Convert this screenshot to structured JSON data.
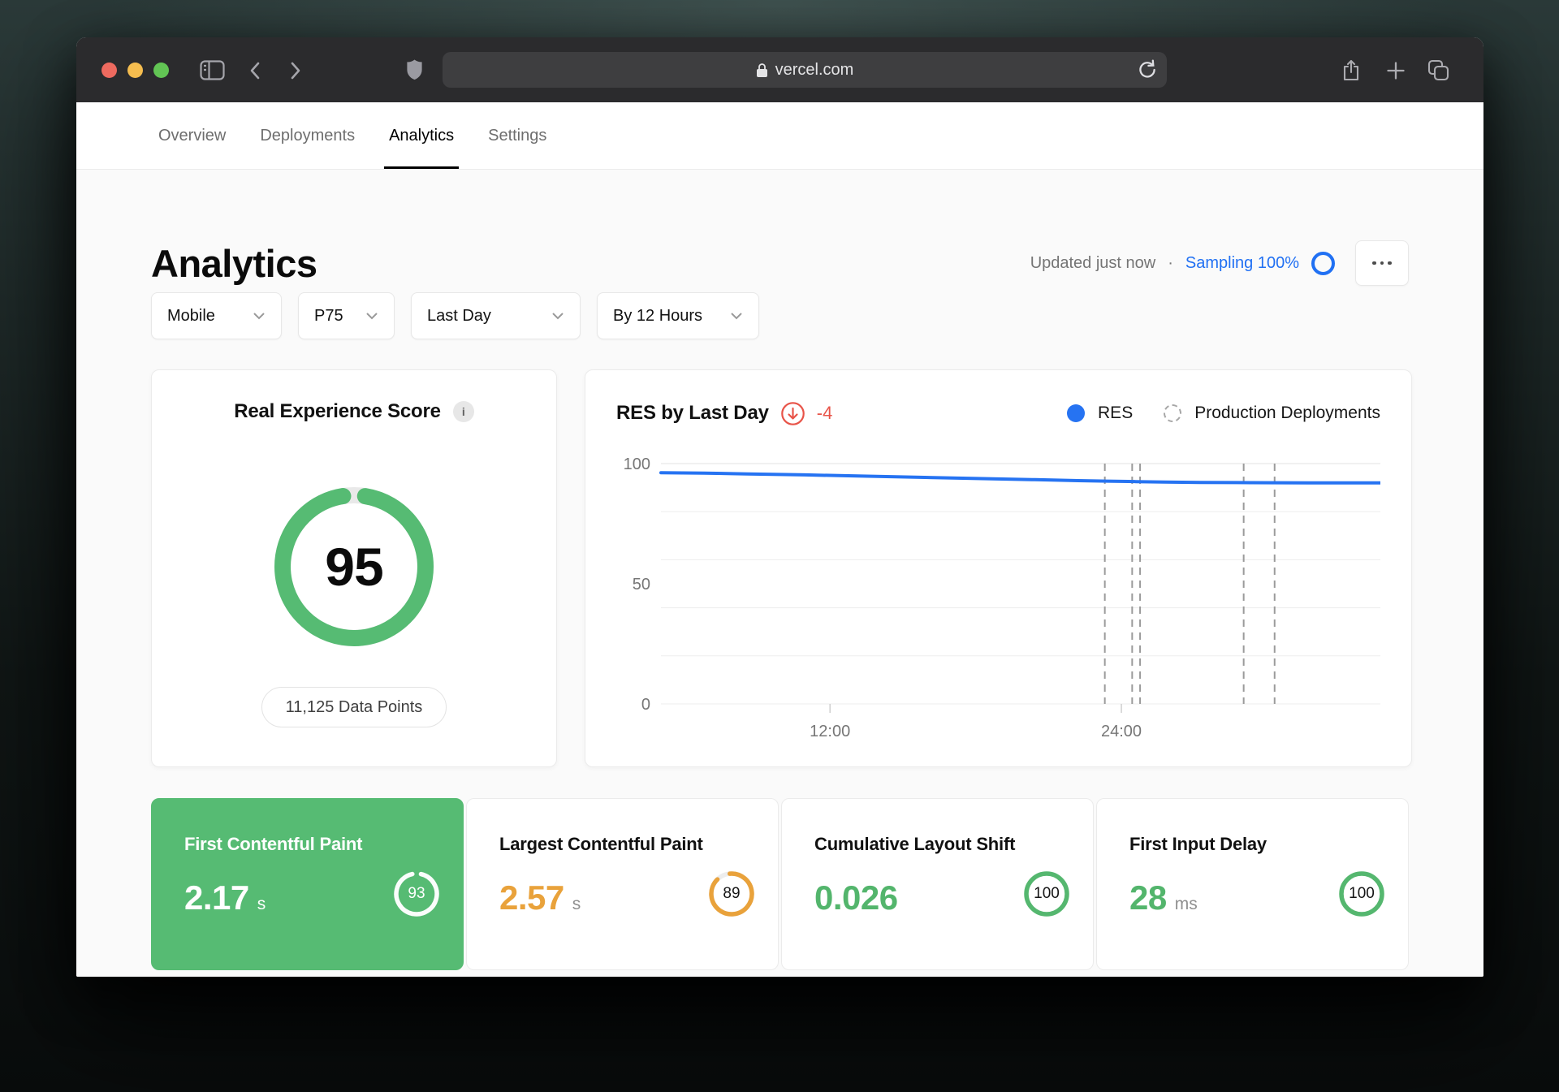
{
  "browser": {
    "url": "vercel.com"
  },
  "tabs": [
    {
      "label": "Overview",
      "active": false
    },
    {
      "label": "Deployments",
      "active": false
    },
    {
      "label": "Analytics",
      "active": true
    },
    {
      "label": "Settings",
      "active": false
    }
  ],
  "header": {
    "title": "Analytics",
    "updated": "Updated just now",
    "separator": "·",
    "sampling": "Sampling 100%"
  },
  "filters": [
    {
      "label": "Mobile"
    },
    {
      "label": "P75"
    },
    {
      "label": "Last Day"
    },
    {
      "label": "By 12 Hours"
    }
  ],
  "res_card": {
    "title": "Real Experience Score",
    "info": "i",
    "score": 95,
    "badge": "11,125 Data Points"
  },
  "chart_data": {
    "type": "line",
    "title": "RES by Last Day",
    "delta": "-4",
    "legend": [
      {
        "label": "RES",
        "marker": "solid-dot",
        "color": "#2673f2"
      },
      {
        "label": "Production Deployments",
        "marker": "dashed-circle",
        "color": "#a6a6a6"
      }
    ],
    "ylim": [
      0,
      100
    ],
    "y_ticks": [
      100,
      50,
      0
    ],
    "y_gridlines": [
      100,
      80,
      60,
      40,
      20,
      0
    ],
    "x_ticks": [
      {
        "label": "12:00",
        "pos": 0.235
      },
      {
        "label": "24:00",
        "pos": 0.64
      }
    ],
    "deployment_markers": [
      0.617,
      0.655,
      0.666,
      0.81,
      0.853
    ],
    "series": [
      {
        "name": "RES",
        "color": "#2673f2",
        "points": [
          [
            0,
            96.2
          ],
          [
            0.06,
            96.0
          ],
          [
            0.12,
            95.7
          ],
          [
            0.2,
            95.3
          ],
          [
            0.28,
            94.8
          ],
          [
            0.36,
            94.3
          ],
          [
            0.44,
            93.8
          ],
          [
            0.52,
            93.3
          ],
          [
            0.58,
            92.9
          ],
          [
            0.62,
            92.7
          ],
          [
            0.66,
            92.5
          ],
          [
            0.7,
            92.3
          ],
          [
            0.75,
            92.15
          ],
          [
            0.82,
            92.05
          ],
          [
            0.9,
            92.0
          ],
          [
            1,
            92.0
          ]
        ]
      }
    ]
  },
  "metrics": [
    {
      "title": "First Contentful Paint",
      "value": "2.17",
      "unit": "s",
      "score": 93,
      "highlighted": true
    },
    {
      "title": "Largest Contentful Paint",
      "value": "2.57",
      "unit": "s",
      "score": 89,
      "highlighted": false
    },
    {
      "title": "Cumulative Layout Shift",
      "value": "0.026",
      "unit": "",
      "score": 100,
      "highlighted": false
    },
    {
      "title": "First Input Delay",
      "value": "28",
      "unit": "ms",
      "score": 100,
      "highlighted": false
    }
  ],
  "colors": {
    "green": "#56bb73",
    "amber": "#e9a23b",
    "blue": "#2673f2",
    "red": "#e85449",
    "page_bg": "#fafafa",
    "titlebar_bg": "#2b2b2d"
  }
}
